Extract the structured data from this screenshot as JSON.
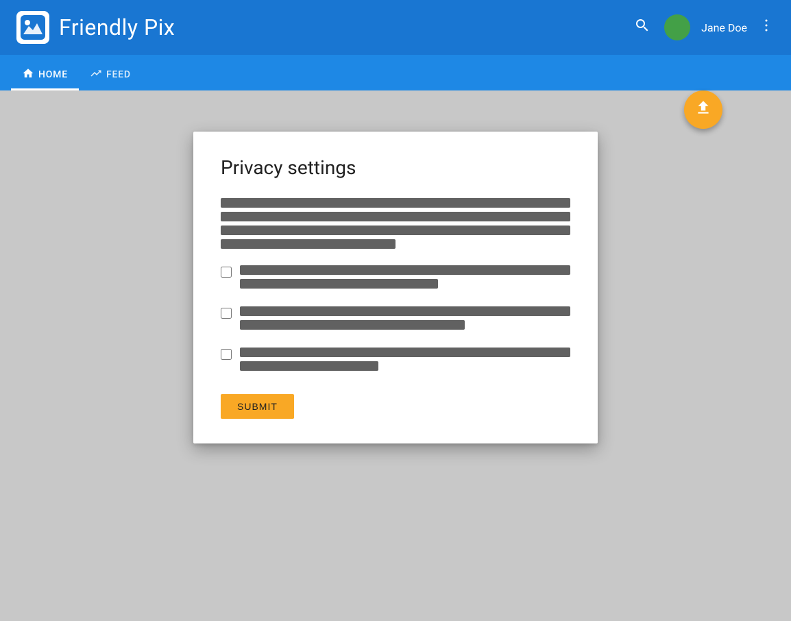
{
  "header": {
    "app_title": "Friendly Pix",
    "search_icon": "🔍",
    "username": "Jane Doe",
    "more_icon": "⋮",
    "upload_icon": "⬆"
  },
  "nav": {
    "tabs": [
      {
        "id": "home",
        "label": "HOME",
        "icon": "🏠",
        "active": true
      },
      {
        "id": "feed",
        "label": "FEED",
        "icon": "📈",
        "active": false
      }
    ]
  },
  "dialog": {
    "title": "Privacy settings",
    "description_lines": [
      "line1",
      "line2",
      "line3",
      "line4_partial"
    ],
    "checkboxes": [
      {
        "id": "cb1",
        "line1": "full",
        "line2": "half"
      },
      {
        "id": "cb2",
        "line1": "full",
        "line2": "partial"
      },
      {
        "id": "cb3",
        "line1": "full",
        "line2": "partial2"
      }
    ],
    "submit_label": "SUBMIT"
  }
}
